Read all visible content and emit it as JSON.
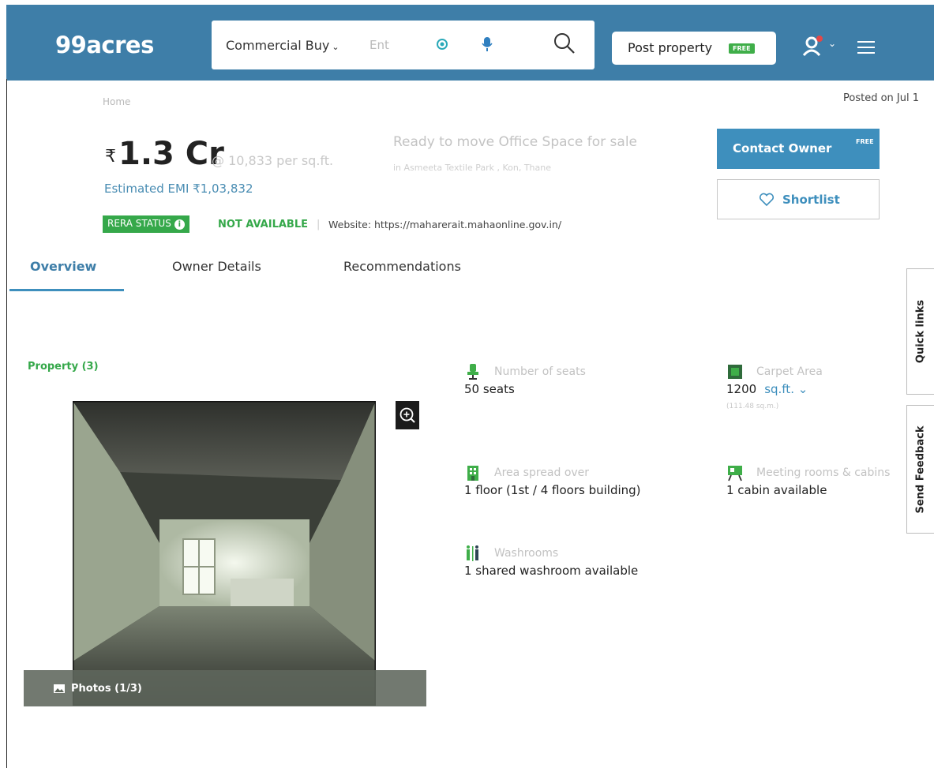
{
  "header": {
    "logo": "99acres",
    "search": {
      "type_label": "Commercial Buy",
      "placeholder": "Ent"
    },
    "post_property": {
      "label": "Post property",
      "badge": "FREE"
    },
    "colors": {
      "bar": "#3e7ea8",
      "free_badge": "#3fae49"
    }
  },
  "breadcrumb": {
    "home": "Home"
  },
  "posted_on": "Posted on Jul 1",
  "listing": {
    "currency": "₹",
    "price": "1.3 Cr",
    "price_per_sqft": "@ 10,833 per sq.ft.",
    "emi": "Estimated EMI ₹1,03,832",
    "title": "Ready to move Office Space for sale",
    "location": "in Asmeeta Textile Park , Kon, Thane",
    "rera": {
      "badge": "RERA STATUS",
      "value": "NOT AVAILABLE",
      "separator": "|",
      "website": "Website: https://maharerait.mahaonline.gov.in/"
    }
  },
  "actions": {
    "contact_owner": "Contact Owner",
    "contact_badge": "FREE",
    "shortlist": "Shortlist"
  },
  "tabs": [
    {
      "label": "Overview",
      "active": true
    },
    {
      "label": "Owner Details",
      "active": false
    },
    {
      "label": "Recommendations",
      "active": false
    }
  ],
  "side_tabs": {
    "quick_links": "Quick links",
    "feedback": "Send Feedback"
  },
  "gallery": {
    "section_label": "Property (3)",
    "photos_label": "Photos (1/3)"
  },
  "features": {
    "seats": {
      "title": "Number of seats",
      "value": "50 seats",
      "icon": "chair-icon"
    },
    "carpet": {
      "title": "Carpet Area",
      "value": "1200",
      "unit": "sq.ft.",
      "sqm": "(111.48 sq.m.)",
      "icon": "carpet-area-icon"
    },
    "area_spread": {
      "title": "Area spread over",
      "value": "1 floor (1st / 4 floors building)",
      "icon": "building-icon"
    },
    "meeting": {
      "title": "Meeting rooms & cabins",
      "value": "1 cabin available",
      "icon": "meeting-board-icon"
    },
    "washrooms": {
      "title": "Washrooms",
      "value": "1 shared washroom available",
      "icon": "washroom-icon"
    }
  }
}
